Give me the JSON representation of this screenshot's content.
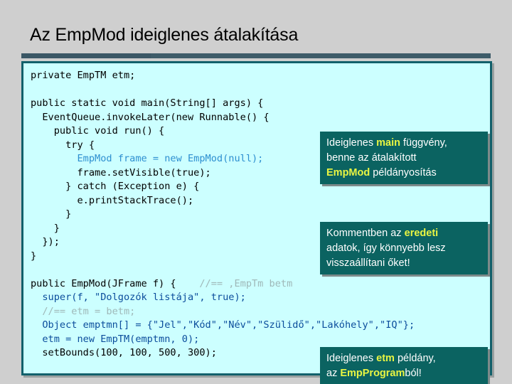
{
  "slide": {
    "title": "Az EmpMod ideiglenes átalakítása"
  },
  "code": {
    "lines": [
      {
        "indent": 0,
        "segments": [
          {
            "text": "private EmpTM etm;",
            "style": "black"
          }
        ]
      },
      {
        "indent": 0,
        "segments": [
          {
            "text": "",
            "style": "black"
          }
        ]
      },
      {
        "indent": 0,
        "segments": [
          {
            "text": "public static void main(String[] args) {",
            "style": "black"
          }
        ]
      },
      {
        "indent": 0,
        "segments": [
          {
            "text": "  EventQueue.invokeLater(new Runnable() {",
            "style": "black"
          }
        ]
      },
      {
        "indent": 0,
        "segments": [
          {
            "text": "    public void run() {",
            "style": "black"
          }
        ]
      },
      {
        "indent": 0,
        "segments": [
          {
            "text": "      try {",
            "style": "black"
          }
        ]
      },
      {
        "indent": 0,
        "segments": [
          {
            "text": "        EmpMod frame = new EmpMod(null);",
            "style": "ltblue"
          }
        ]
      },
      {
        "indent": 0,
        "segments": [
          {
            "text": "        frame.setVisible(true);",
            "style": "black"
          }
        ]
      },
      {
        "indent": 0,
        "segments": [
          {
            "text": "      } catch (Exception e) {",
            "style": "black"
          }
        ]
      },
      {
        "indent": 0,
        "segments": [
          {
            "text": "        e.printStackTrace();",
            "style": "black"
          }
        ]
      },
      {
        "indent": 0,
        "segments": [
          {
            "text": "      }",
            "style": "black"
          }
        ]
      },
      {
        "indent": 0,
        "segments": [
          {
            "text": "    }",
            "style": "black"
          }
        ]
      },
      {
        "indent": 0,
        "segments": [
          {
            "text": "  });",
            "style": "black"
          }
        ]
      },
      {
        "indent": 0,
        "segments": [
          {
            "text": "}",
            "style": "black"
          }
        ]
      },
      {
        "indent": 0,
        "segments": [
          {
            "text": "",
            "style": "black"
          }
        ]
      },
      {
        "indent": 0,
        "segments": [
          {
            "text": "public EmpMod(JFrame f) {",
            "style": "black"
          },
          {
            "text": "    //== ,EmpTm betm",
            "style": "gray"
          }
        ]
      },
      {
        "indent": 0,
        "segments": [
          {
            "text": "  super(f, \"Dolgozók listája\", true);",
            "style": "blue"
          }
        ]
      },
      {
        "indent": 0,
        "segments": [
          {
            "text": "  //== etm = betm;",
            "style": "gray"
          }
        ]
      },
      {
        "indent": 0,
        "segments": [
          {
            "text": "  Object emptmn[] = {\"Jel\",\"Kód\",\"Név\",\"Szülidő\",\"Lakóhely\",\"IQ\"};",
            "style": "blue"
          }
        ]
      },
      {
        "indent": 0,
        "segments": [
          {
            "text": "  etm = new EmpTM(emptmn, 0);",
            "style": "blue"
          }
        ]
      },
      {
        "indent": 0,
        "segments": [
          {
            "text": "  setBounds(100, 100, 500, 300);",
            "style": "black"
          }
        ]
      }
    ]
  },
  "callouts": [
    {
      "id": "callout-1",
      "parts": [
        {
          "text": "Ideiglenes ",
          "highlight": false
        },
        {
          "text": "main",
          "highlight": true
        },
        {
          "text": " függvény,",
          "highlight": false
        },
        {
          "text": "\n",
          "highlight": false
        },
        {
          "text": "benne az átalakított",
          "highlight": false
        },
        {
          "text": "\n",
          "highlight": false
        },
        {
          "text": "EmpMod",
          "highlight": true
        },
        {
          "text": " példányosítás",
          "highlight": false
        }
      ]
    },
    {
      "id": "callout-2",
      "parts": [
        {
          "text": "Kommentben az ",
          "highlight": false
        },
        {
          "text": "eredeti",
          "highlight": true
        },
        {
          "text": "\n",
          "highlight": false
        },
        {
          "text": "adatok, így könnyebb lesz",
          "highlight": false
        },
        {
          "text": "\n",
          "highlight": false
        },
        {
          "text": "visszaállítani őket!",
          "highlight": false
        }
      ]
    },
    {
      "id": "callout-3",
      "parts": [
        {
          "text": "Ideiglenes ",
          "highlight": false
        },
        {
          "text": "etm",
          "highlight": true
        },
        {
          "text": " példány,",
          "highlight": false
        },
        {
          "text": "\n",
          "highlight": false
        },
        {
          "text": "az ",
          "highlight": false
        },
        {
          "text": "EmpProgram",
          "highlight": true
        },
        {
          "text": "ból!",
          "highlight": false
        }
      ]
    }
  ],
  "colors": {
    "slide_background": "#cfcfcf",
    "code_background": "#ccffff",
    "code_border": "#12606b",
    "divider_bar": "#3e5c69",
    "callout_background": "#0b6361",
    "callout_highlight": "#e9f542",
    "code_blue": "#0b4d9c",
    "code_light_blue": "#2d8fd0",
    "code_comment_gray": "#9fb8b8"
  }
}
